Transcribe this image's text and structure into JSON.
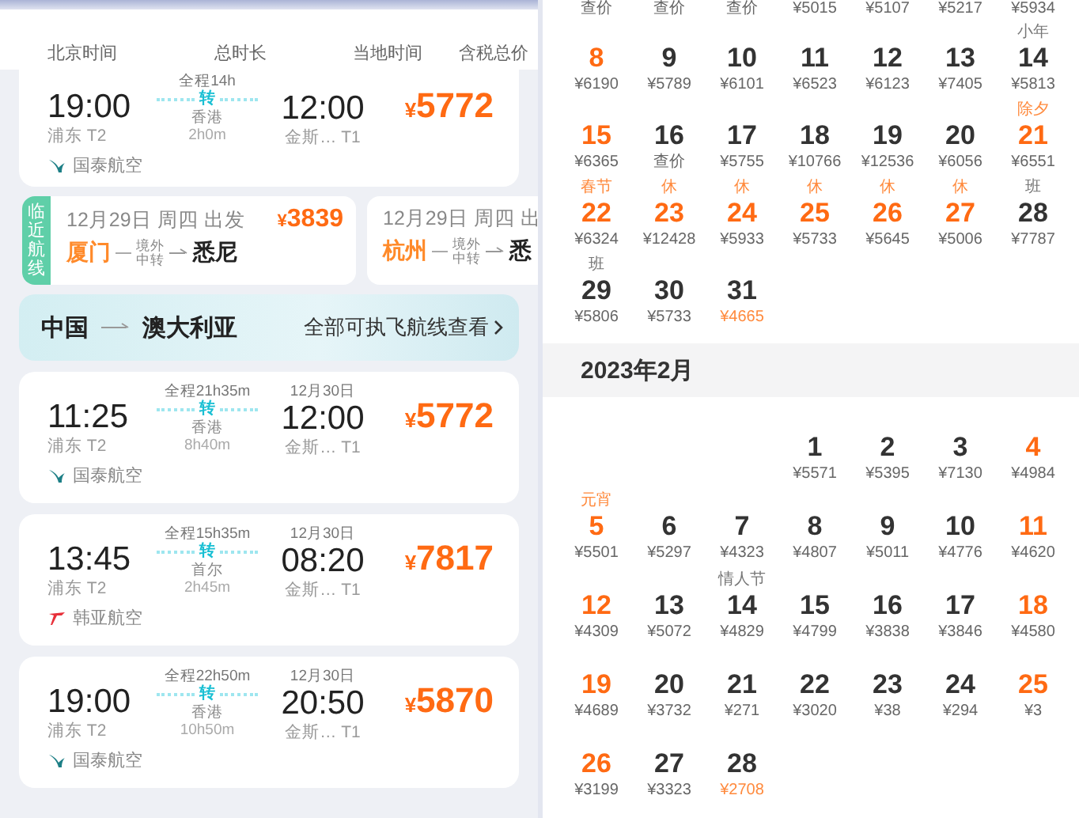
{
  "left": {
    "columns": [
      "北京时间",
      "总时长",
      "当地时间",
      "含税总价"
    ],
    "flights": [
      {
        "dep_time": "19:00",
        "dep_airport": "浦东 T2",
        "duration": "全程14h",
        "transfer": "转",
        "via": "香港",
        "layover": "2h0m",
        "arr_time": "12:00",
        "arr_airport": "金斯… T1",
        "price": "¥5772",
        "airline": "国泰航空",
        "kind": "swoosh",
        "color": "#1d7f86"
      },
      {
        "dep_time": "11:25",
        "dep_airport": "浦东 T2",
        "duration": "全程21h35m",
        "transfer": "转",
        "via": "香港",
        "layover": "8h40m",
        "arr_date": "12月30日",
        "arr_time": "12:00",
        "arr_airport": "金斯… T1",
        "price": "¥5772",
        "airline": "国泰航空",
        "kind": "swoosh",
        "color": "#1d7f86"
      },
      {
        "dep_time": "13:45",
        "dep_airport": "浦东 T2",
        "duration": "全程15h35m",
        "transfer": "转",
        "via": "首尔",
        "layover": "2h45m",
        "arr_date": "12月30日",
        "arr_time": "08:20",
        "arr_airport": "金斯… T1",
        "price": "¥7817",
        "airline": "韩亚航空",
        "kind": "wing",
        "color": "#e8303a"
      },
      {
        "dep_time": "19:00",
        "dep_airport": "浦东 T2",
        "duration": "全程22h50m",
        "transfer": "转",
        "via": "香港",
        "layover": "10h50m",
        "arr_date": "12月30日",
        "arr_time": "20:50",
        "arr_airport": "金斯… T1",
        "price": "¥5870",
        "airline": "国泰航空",
        "kind": "swoosh",
        "color": "#1d7f86"
      }
    ],
    "nearby": {
      "tag": "临近航线",
      "routes": [
        {
          "date": "12月29日 周四 出发",
          "price": "¥3839",
          "from": "厦门",
          "via_top": "境外",
          "via_bottom": "中转",
          "to": "悉尼"
        },
        {
          "date": "12月29日 周四 出",
          "from": "杭州",
          "via_top": "境外",
          "via_bottom": "中转",
          "to": "悉"
        }
      ]
    },
    "banner": {
      "from": "中国",
      "to": "澳大利亚",
      "link": "全部可执飞航线查看"
    }
  },
  "calendar": {
    "cut_prices": [
      "查价",
      "查价",
      "查价",
      "¥5015",
      "¥5107",
      "¥5217",
      "¥5934"
    ],
    "months": [
      {
        "weeks": [
          [
            {
              "kind": "day",
              "day": "8",
              "price": "¥6190",
              "highlight": true,
              "lowest": false
            },
            {
              "kind": "day",
              "day": "9",
              "price": "¥5789",
              "highlight": false,
              "lowest": false
            },
            {
              "kind": "day",
              "day": "10",
              "price": "¥6101",
              "highlight": false,
              "lowest": false
            },
            {
              "kind": "day",
              "day": "11",
              "price": "¥6523",
              "highlight": false,
              "lowest": false
            },
            {
              "kind": "day",
              "day": "12",
              "price": "¥6123",
              "highlight": false,
              "lowest": false
            },
            {
              "kind": "day",
              "day": "13",
              "price": "¥7405",
              "highlight": false,
              "lowest": false
            },
            {
              "kind": "day",
              "day": "14",
              "price": "¥5813",
              "highlight": false,
              "lowest": false,
              "note": "小年",
              "holiday_note": false
            }
          ],
          [
            {
              "kind": "day",
              "day": "15",
              "price": "¥6365",
              "highlight": true,
              "lowest": false
            },
            {
              "kind": "day",
              "day": "16",
              "price": "查价",
              "highlight": false,
              "lowest": false
            },
            {
              "kind": "day",
              "day": "17",
              "price": "¥5755",
              "highlight": false,
              "lowest": false
            },
            {
              "kind": "day",
              "day": "18",
              "price": "¥10766",
              "highlight": false,
              "lowest": false
            },
            {
              "kind": "day",
              "day": "19",
              "price": "¥12536",
              "highlight": false,
              "lowest": false
            },
            {
              "kind": "day",
              "day": "20",
              "price": "¥6056",
              "highlight": false,
              "lowest": false
            },
            {
              "kind": "day",
              "day": "21",
              "price": "¥6551",
              "highlight": true,
              "lowest": false,
              "note": "除夕",
              "holiday_note": true
            }
          ],
          [
            {
              "kind": "day",
              "day": "22",
              "price": "¥6324",
              "highlight": true,
              "lowest": false,
              "note": "春节",
              "holiday_note": true
            },
            {
              "kind": "day",
              "day": "23",
              "price": "¥12428",
              "highlight": true,
              "lowest": false,
              "note": "休",
              "holiday_note": true
            },
            {
              "kind": "day",
              "day": "24",
              "price": "¥5933",
              "highlight": true,
              "lowest": false,
              "note": "休",
              "holiday_note": true
            },
            {
              "kind": "day",
              "day": "25",
              "price": "¥5733",
              "highlight": true,
              "lowest": false,
              "note": "休",
              "holiday_note": true
            },
            {
              "kind": "day",
              "day": "26",
              "price": "¥5645",
              "highlight": true,
              "lowest": false,
              "note": "休",
              "holiday_note": true
            },
            {
              "kind": "day",
              "day": "27",
              "price": "¥5006",
              "highlight": true,
              "lowest": false,
              "note": "休",
              "holiday_note": true
            },
            {
              "kind": "day",
              "day": "28",
              "price": "¥7787",
              "highlight": false,
              "lowest": false,
              "note": "班",
              "holiday_note": false
            }
          ],
          [
            {
              "kind": "day",
              "day": "29",
              "price": "¥5806",
              "highlight": false,
              "lowest": false,
              "note": "班",
              "holiday_note": false
            },
            {
              "kind": "day",
              "day": "30",
              "price": "¥5733",
              "highlight": false,
              "lowest": false
            },
            {
              "kind": "day",
              "day": "31",
              "price": "¥4665",
              "highlight": false,
              "lowest": true
            }
          ]
        ]
      },
      {
        "title": "2023年2月",
        "weeks": [
          [
            {
              "kind": "blank"
            },
            {
              "kind": "blank"
            },
            {
              "kind": "blank"
            },
            {
              "kind": "day",
              "day": "1",
              "price": "¥5571",
              "highlight": false,
              "lowest": false
            },
            {
              "kind": "day",
              "day": "2",
              "price": "¥5395",
              "highlight": false,
              "lowest": false
            },
            {
              "kind": "day",
              "day": "3",
              "price": "¥7130",
              "highlight": false,
              "lowest": false
            },
            {
              "kind": "day",
              "day": "4",
              "price": "¥4984",
              "highlight": true,
              "lowest": false
            }
          ],
          [
            {
              "kind": "day",
              "day": "5",
              "price": "¥5501",
              "highlight": true,
              "lowest": false,
              "note": "元宵",
              "holiday_note": true
            },
            {
              "kind": "day",
              "day": "6",
              "price": "¥5297",
              "highlight": false,
              "lowest": false
            },
            {
              "kind": "day",
              "day": "7",
              "price": "¥4323",
              "highlight": false,
              "lowest": false
            },
            {
              "kind": "day",
              "day": "8",
              "price": "¥4807",
              "highlight": false,
              "lowest": false
            },
            {
              "kind": "day",
              "day": "9",
              "price": "¥5011",
              "highlight": false,
              "lowest": false
            },
            {
              "kind": "day",
              "day": "10",
              "price": "¥4776",
              "highlight": false,
              "lowest": false
            },
            {
              "kind": "day",
              "day": "11",
              "price": "¥4620",
              "highlight": true,
              "lowest": false
            }
          ],
          [
            {
              "kind": "day",
              "day": "12",
              "price": "¥4309",
              "highlight": true,
              "lowest": false
            },
            {
              "kind": "day",
              "day": "13",
              "price": "¥5072",
              "highlight": false,
              "lowest": false
            },
            {
              "kind": "day",
              "day": "14",
              "price": "¥4829",
              "highlight": false,
              "lowest": false,
              "note": "情人节",
              "holiday_note": false
            },
            {
              "kind": "day",
              "day": "15",
              "price": "¥4799",
              "highlight": false,
              "lowest": false
            },
            {
              "kind": "day",
              "day": "16",
              "price": "¥3838",
              "highlight": false,
              "lowest": false
            },
            {
              "kind": "day",
              "day": "17",
              "price": "¥3846",
              "highlight": false,
              "lowest": false
            },
            {
              "kind": "day",
              "day": "18",
              "price": "¥4580",
              "highlight": true,
              "lowest": false
            }
          ],
          [
            {
              "kind": "day",
              "day": "19",
              "price": "¥4689",
              "highlight": true,
              "lowest": false
            },
            {
              "kind": "day",
              "day": "20",
              "price": "¥3732",
              "highlight": false,
              "lowest": false
            },
            {
              "kind": "day",
              "day": "21",
              "price": "¥271",
              "highlight": false,
              "lowest": false
            },
            {
              "kind": "day",
              "day": "22",
              "price": "¥3020",
              "highlight": false,
              "lowest": false
            },
            {
              "kind": "day",
              "day": "23",
              "price": "¥38",
              "highlight": false,
              "lowest": false
            },
            {
              "kind": "day",
              "day": "24",
              "price": "¥294",
              "highlight": false,
              "lowest": false
            },
            {
              "kind": "day",
              "day": "25",
              "price": "¥3",
              "highlight": true,
              "lowest": false
            }
          ],
          [
            {
              "kind": "day",
              "day": "26",
              "price": "¥3199",
              "highlight": true,
              "lowest": false
            },
            {
              "kind": "day",
              "day": "27",
              "price": "¥3323",
              "highlight": false,
              "lowest": false
            },
            {
              "kind": "day",
              "day": "28",
              "price": "¥2708",
              "highlight": false,
              "lowest": true
            }
          ]
        ]
      }
    ]
  }
}
